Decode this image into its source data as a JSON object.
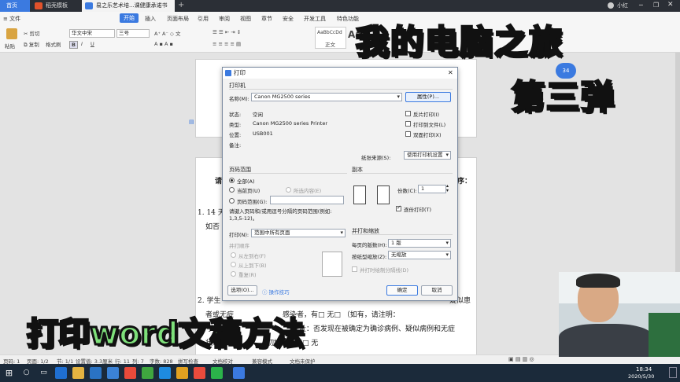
{
  "tabs": [
    {
      "label": "首页",
      "color": "#3b7ae0"
    },
    {
      "label": "稻壳模板",
      "color": "#e2522b"
    },
    {
      "label": "易之乐艺术培...课健康承诺书",
      "color": "#3b7ae0"
    }
  ],
  "tabbar_right": {
    "user": "小红"
  },
  "ribbon": {
    "file_menu": "文件",
    "menus": [
      "开始",
      "插入",
      "页面布局",
      "引用",
      "审阅",
      "视图",
      "章节",
      "安全",
      "开发工具",
      "特色功能"
    ],
    "buttons": {
      "paste": "粘贴",
      "cut": "剪切",
      "copy": "复制",
      "format_painter": "格式刷"
    },
    "font_name": "华文中宋",
    "font_size": "三号",
    "style_preview": "AaBbCcDd",
    "style_name": "正文",
    "style_preview2": "Aa"
  },
  "document": {
    "lines": [
      "1. 14 天",
      "如否",
      "2. 学生",
      "者或无症",
      "感染者，有□  无□  （如有，请注明：",
      "3. 学生",
      "住址：否发现在被确定为确诊病例、疑似病例和无症",
      "状感染者",
      "切接者：有□  无"
    ],
    "right_fragments": [
      "疑似患",
      "序："
    ],
    "qr_text": "请"
  },
  "dialog": {
    "title": "打印",
    "printer_group": "打印机",
    "name_label": "名称(M):",
    "printer_name": "Canon MG2500 series",
    "properties_button": "属性(P)...",
    "status_label": "状态:",
    "status_value": "空闲",
    "type_label": "类型:",
    "type_value": "Canon MG2500 series Printer",
    "location_label": "位置:",
    "location_value": "USB001",
    "comment_label": "备注:",
    "reverse_print": "反片打印(I)",
    "print_to_file": "打印到文件(L)",
    "duplex": "双面打印(X)",
    "paper_source_label": "纸张来源(S):",
    "paper_source_value": "使用打印机设置",
    "range_group": "页码范围",
    "all": "全部(A)",
    "current_page": "当前页(U)",
    "selection": "所选内容(E)",
    "pages": "页码范围(G):",
    "pages_hint": "请键入页码和/或用逗号分隔的页码范围(例如: 1,3,5-12)。",
    "print_label": "打印(N):",
    "print_value": "范围中所有页面",
    "order_group": "并打顺序",
    "order_lr": "从左到右(F)",
    "order_tb": "从上到下(B)",
    "order_repeat": "重复(R)",
    "copies_group": "副本",
    "copies_label": "份数(C):",
    "copies_value": "1",
    "collate": "逐份打印(T)",
    "zoom_group": "并打和缩放",
    "pages_per_sheet_label": "每页的版数(H):",
    "pages_per_sheet_value": "1 版",
    "scale_label": "按纸型缩放(Z):",
    "scale_value": "无缩放",
    "draw_lines": "并打时绘制分隔线(D)",
    "options_button": "选项(O)...",
    "tips_link": "操作技巧",
    "ok_button": "确定",
    "cancel_button": "取消"
  },
  "status_bar": {
    "page": "页码: 1",
    "pages": "页面: 1/2",
    "section": "节: 1/1",
    "settings": "设置值: 3.3厘米",
    "row": "行: 11",
    "col": "列: 7",
    "words": "字数: 828",
    "spell": "拼写检查",
    "doc_check": "文档校对",
    "compat": "兼容模式",
    "protect": "文档未保护"
  },
  "taskbar": {
    "time": "18:34",
    "date": "2020/5/30"
  },
  "overlay": {
    "title1": "我的电脑之旅",
    "title2": "第三弹",
    "bottom": "打印word文稿方法",
    "badge": "34"
  },
  "colors": {
    "accent": "#3b7ae0",
    "title_green": "#3fd39a",
    "title_yellow": "#f6d21a",
    "bottom_green": "#7ee07a"
  }
}
